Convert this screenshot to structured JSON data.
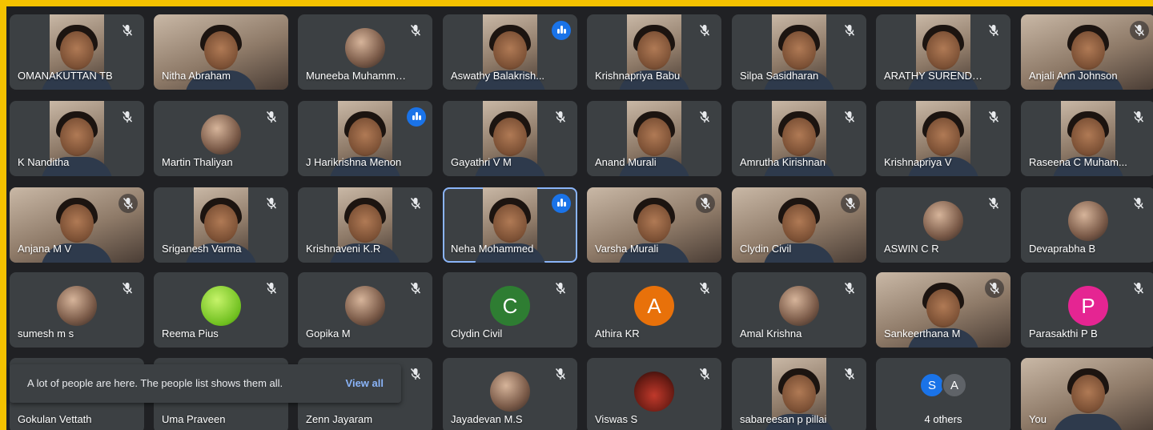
{
  "meeting": {
    "participants": [
      {
        "name": "OMANAKUTTAN TB",
        "state": "muted",
        "media": "video-narrow"
      },
      {
        "name": "Nitha Abraham",
        "state": "none",
        "media": "video-wide"
      },
      {
        "name": "Muneeba Muhamme...",
        "state": "muted",
        "media": "avatar"
      },
      {
        "name": "Aswathy Balakrish...",
        "state": "speaking",
        "media": "video-narrow"
      },
      {
        "name": "Krishnapriya Babu",
        "state": "muted",
        "media": "video-narrow"
      },
      {
        "name": "Silpa Sasidharan",
        "state": "muted",
        "media": "video-narrow"
      },
      {
        "name": "ARATHY SURENDR...",
        "state": "muted",
        "media": "video-narrow"
      },
      {
        "name": "Anjali Ann Johnson",
        "state": "muted-dim",
        "media": "video-wide"
      },
      {
        "name": "K Nanditha",
        "state": "muted",
        "media": "video-narrow"
      },
      {
        "name": "Martin Thaliyan",
        "state": "muted",
        "media": "avatar"
      },
      {
        "name": "J Harikrishna Menon",
        "state": "speaking",
        "media": "video-narrow"
      },
      {
        "name": "Gayathri V M",
        "state": "muted",
        "media": "video-narrow"
      },
      {
        "name": "Anand Murali",
        "state": "muted",
        "media": "video-narrow"
      },
      {
        "name": "Amrutha Kirishnan",
        "state": "muted",
        "media": "video-narrow"
      },
      {
        "name": "Krishnapriya V",
        "state": "muted",
        "media": "video-narrow"
      },
      {
        "name": "Raseena C Muham...",
        "state": "muted",
        "media": "video-narrow"
      },
      {
        "name": "Anjana M V",
        "state": "muted-dim",
        "media": "video-wide"
      },
      {
        "name": "Sriganesh Varma",
        "state": "muted",
        "media": "video-narrow"
      },
      {
        "name": "Krishnaveni K.R",
        "state": "muted",
        "media": "video-narrow"
      },
      {
        "name": "Neha Mohammed",
        "state": "speaking-active",
        "media": "video-narrow"
      },
      {
        "name": "Varsha Murali",
        "state": "muted-dim",
        "media": "video-wide"
      },
      {
        "name": "Clydin Civil",
        "state": "muted-dim",
        "media": "video-wide"
      },
      {
        "name": "ASWIN C R",
        "state": "muted",
        "media": "avatar"
      },
      {
        "name": "Devaprabha B",
        "state": "muted",
        "media": "avatar"
      },
      {
        "name": "sumesh m s",
        "state": "muted",
        "media": "avatar"
      },
      {
        "name": "Reema Pius",
        "state": "muted",
        "media": "avatar-green"
      },
      {
        "name": "Gopika M",
        "state": "muted",
        "media": "avatar"
      },
      {
        "name": "Clydin Civil",
        "state": "muted",
        "media": "letter",
        "letter": "C",
        "color": "#2e7d32"
      },
      {
        "name": "Athira KR",
        "state": "muted",
        "media": "letter",
        "letter": "A",
        "color": "#e8710a"
      },
      {
        "name": "Amal Krishna",
        "state": "muted",
        "media": "avatar"
      },
      {
        "name": "Sankeerthana M",
        "state": "muted-dim",
        "media": "video-wide"
      },
      {
        "name": "Parasakthi P B",
        "state": "muted",
        "media": "letter",
        "letter": "P",
        "color": "#e52592"
      },
      {
        "name": "Gokulan Vettath",
        "state": "none",
        "media": "blank"
      },
      {
        "name": "Uma Praveen",
        "state": "none",
        "media": "blank"
      },
      {
        "name": "Zenn Jayaram",
        "state": "muted",
        "media": "blank"
      },
      {
        "name": "Jayadevan M.S",
        "state": "muted",
        "media": "avatar"
      },
      {
        "name": "Viswas S",
        "state": "muted",
        "media": "avatar-red"
      },
      {
        "name": "sabareesan p pillai",
        "state": "muted",
        "media": "video-narrow"
      },
      {
        "name": "4 others",
        "state": "others",
        "media": "others",
        "others": [
          {
            "letter": "S",
            "color": "#1a73e8"
          },
          {
            "letter": "A",
            "color": "#5f6368"
          }
        ]
      },
      {
        "name": "You",
        "state": "none",
        "media": "video-wide"
      }
    ]
  },
  "toast": {
    "message": "A lot of people are here. The people list shows them all.",
    "action": "View all"
  },
  "colors": {
    "frame": "#f5c200",
    "background": "#202124",
    "tile": "#3c4043",
    "speaking": "#1a73e8",
    "link": "#8ab4f8"
  }
}
